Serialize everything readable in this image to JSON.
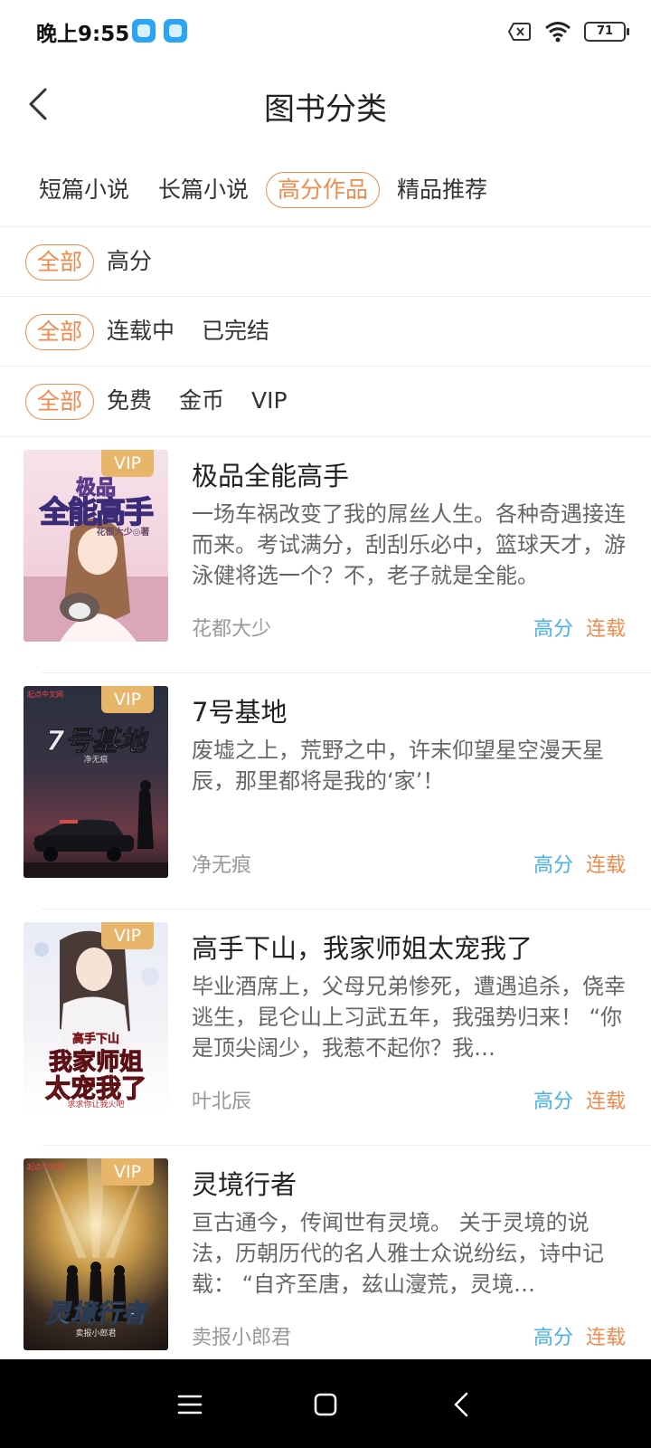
{
  "status_bar": {
    "time": "晚上9:55",
    "battery": "71"
  },
  "header": {
    "title": "图书分类"
  },
  "tabs": [
    {
      "label": "短篇小说",
      "active": false
    },
    {
      "label": "长篇小说",
      "active": false
    },
    {
      "label": "高分作品",
      "active": true
    },
    {
      "label": "精品推荐",
      "active": false
    }
  ],
  "filters": {
    "rating": [
      "全部",
      "高分"
    ],
    "status": [
      "全部",
      "连载中",
      "已完结"
    ],
    "price": [
      "全部",
      "免费",
      "金币",
      "VIP"
    ]
  },
  "books": [
    {
      "title": "极品全能高手",
      "desc": "一场车祸改变了我的屌丝人生。各种奇遇接连而来。考试满分，刮刮乐必中，篮球天才，游泳健将选一个？不，老子就是全能。",
      "author": "花都大少",
      "score_tag": "高分",
      "status_tag": "连载",
      "vip": "VIP",
      "cover_text": [
        "极品",
        "全能高手",
        "花都大少◎著"
      ]
    },
    {
      "title": "7号基地",
      "desc": "废墟之上，荒野之中，许末仰望星空漫天星辰，那里都将是我的‘家’！",
      "author": "净无痕",
      "score_tag": "高分",
      "status_tag": "连载",
      "vip": "VIP",
      "cover_text": [
        "起点中文网",
        "7号基地",
        "净无痕"
      ]
    },
    {
      "title": "高手下山，我家师姐太宠我了",
      "desc": "毕业酒席上，父母兄弟惨死，遭遇追杀，侥幸逃生，昆仑山上习武五年，我强势归来！ “你是顶尖阔少，我惹不起你？我…",
      "author": "叶北辰",
      "score_tag": "高分",
      "status_tag": "连载",
      "vip": "VIP",
      "cover_text": [
        "高手下山",
        "我家师姐",
        "太宠我了",
        "求求你让我火吧"
      ]
    },
    {
      "title": "灵境行者",
      "desc": "亘古通今，传闻世有灵境。 关于灵境的说法，历朝历代的名人雅士众说纷纭，诗中记载： “自齐至唐，兹山濅荒，灵境…",
      "author": "卖报小郎君",
      "score_tag": "高分",
      "status_tag": "连载",
      "vip": "VIP",
      "cover_text": [
        "起点中文网",
        "灵境行者",
        "卖报小郎君"
      ]
    }
  ],
  "colors": {
    "accent": "#ef8b4e",
    "score": "#4ab1e8",
    "vip": "#e8b66a"
  },
  "icons": [
    "back-arrow-icon",
    "wifi-icon",
    "no-sim-icon",
    "battery-icon",
    "menu-icon",
    "home-icon",
    "nav-back-icon"
  ]
}
